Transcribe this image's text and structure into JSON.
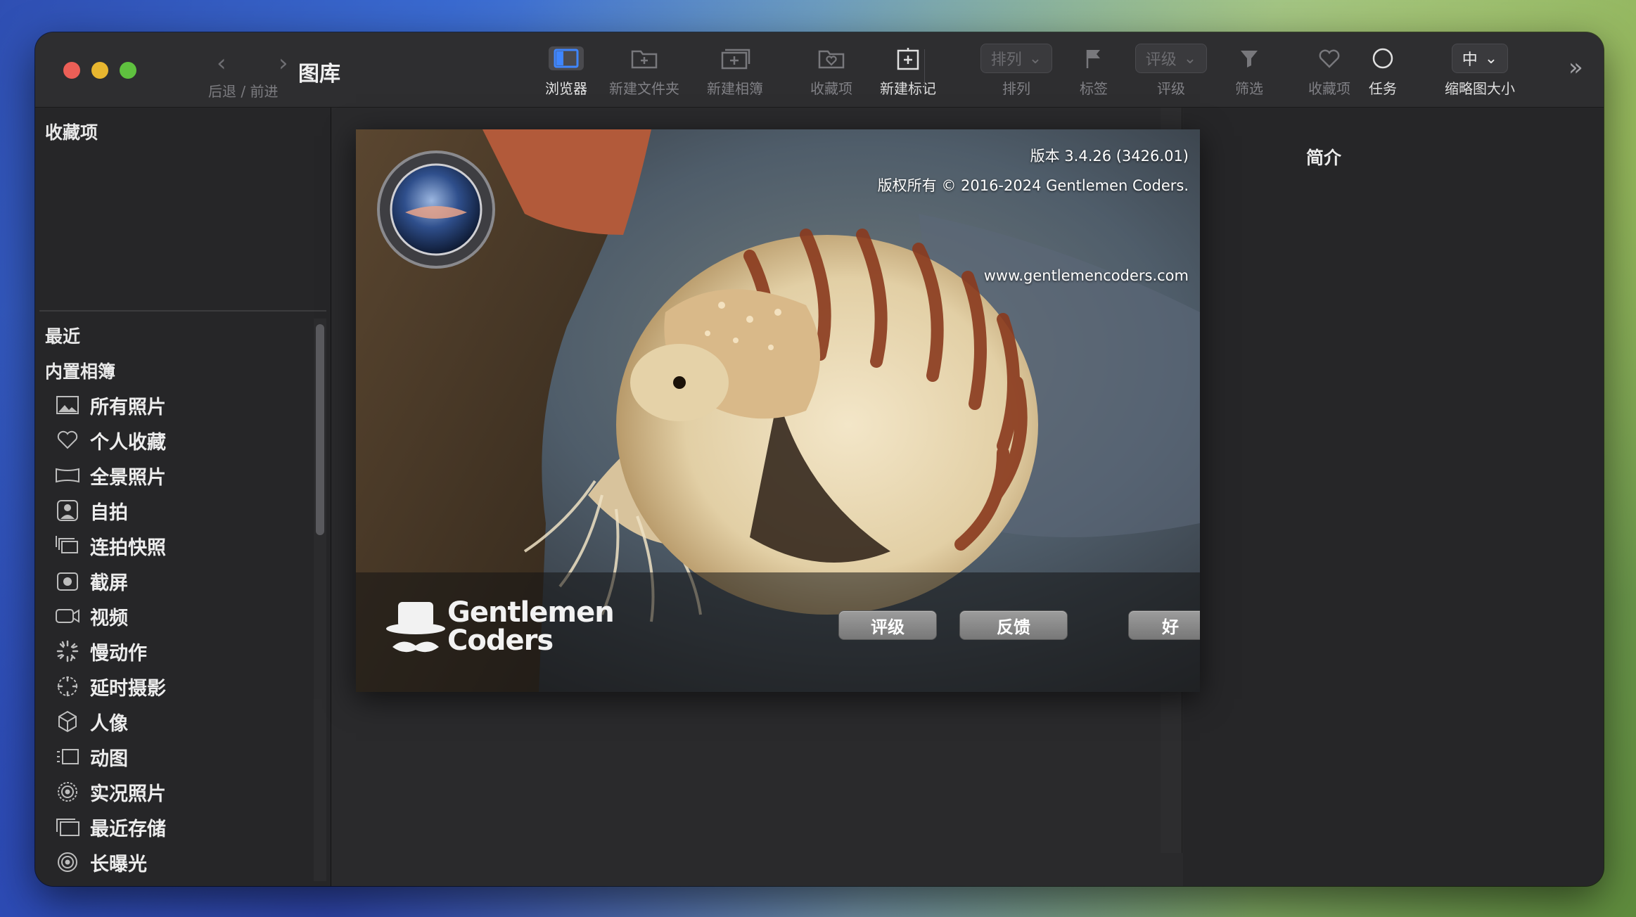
{
  "window": {
    "title": "图库"
  },
  "nav": {
    "back_forward_label": "后退 / 前进"
  },
  "toolbar": {
    "browser": "浏览器",
    "new_folder": "新建文件夹",
    "new_album": "新建相簿",
    "favorites_add": "收藏项",
    "new_tag": "新建标记",
    "sort_value": "排列",
    "sort_label": "排列",
    "tags_label": "标签",
    "rating_value": "评级",
    "rating_label": "评级",
    "filter_label": "筛选",
    "favorites_label": "收藏项",
    "tasks_label": "任务",
    "thumb_size_value": "中",
    "thumb_size_label": "缩略图大小"
  },
  "sidebar": {
    "favorites_header": "收藏项",
    "recent_header": "最近",
    "builtin_header": "内置相簿",
    "items": [
      {
        "label": "所有照片",
        "icon": "photos-icon"
      },
      {
        "label": "个人收藏",
        "icon": "heart-icon"
      },
      {
        "label": "全景照片",
        "icon": "panorama-icon"
      },
      {
        "label": "自拍",
        "icon": "selfie-icon"
      },
      {
        "label": "连拍快照",
        "icon": "burst-icon"
      },
      {
        "label": "截屏",
        "icon": "screenshot-icon"
      },
      {
        "label": "视频",
        "icon": "video-icon"
      },
      {
        "label": "慢动作",
        "icon": "slomo-icon"
      },
      {
        "label": "延时摄影",
        "icon": "timelapse-icon"
      },
      {
        "label": "人像",
        "icon": "portrait-cube-icon"
      },
      {
        "label": "动图",
        "icon": "animated-icon"
      },
      {
        "label": "实况照片",
        "icon": "live-photo-icon"
      },
      {
        "label": "最近存储",
        "icon": "recently-saved-icon"
      },
      {
        "label": "长曝光",
        "icon": "long-exposure-icon"
      }
    ]
  },
  "info_panel": {
    "title": "简介"
  },
  "about": {
    "version": "版本 3.4.26 (3426.01)",
    "copyright": "版权所有 © 2016-2024 Gentlemen Coders.",
    "website": "www.gentlemencoders.com",
    "brand_line1": "Gentlemen",
    "brand_line2": "Coders",
    "rate_button": "评级",
    "feedback_button": "反馈",
    "ok_button": "好"
  },
  "colors": {
    "close": "#ec5f57",
    "minimize": "#e8b62f",
    "zoom": "#5fc13f",
    "accent": "#3f86ff"
  }
}
